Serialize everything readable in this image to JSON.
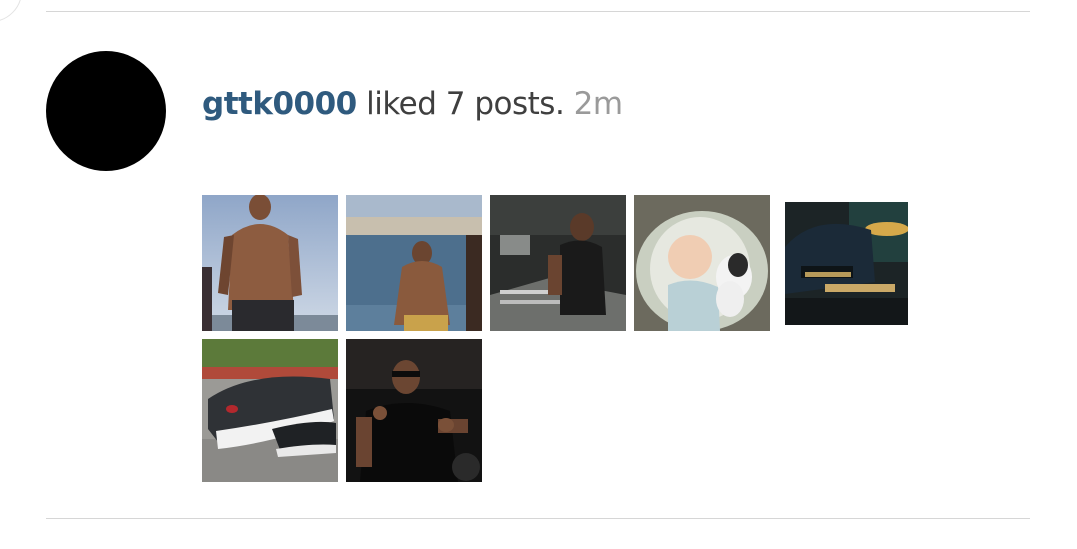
{
  "notification": {
    "username": "gttk0000",
    "action_text": " liked 7 posts.",
    "time_ago": "2m"
  },
  "avatar": {
    "color": "#000000"
  },
  "colors": {
    "username": "#2f5a7e",
    "text": "#3f3f3f",
    "time": "#9a9a9a",
    "divider": "#d6d6d6"
  },
  "posts": [
    {
      "icon": "photo-shirtless-man-sky"
    },
    {
      "icon": "photo-man-by-sea"
    },
    {
      "icon": "photo-man-in-studio"
    },
    {
      "icon": "photo-baby-with-puppy"
    },
    {
      "icon": "photo-cap-on-table"
    },
    {
      "icon": "photo-sneakers"
    },
    {
      "icon": "photo-man-in-black-shirt"
    }
  ]
}
